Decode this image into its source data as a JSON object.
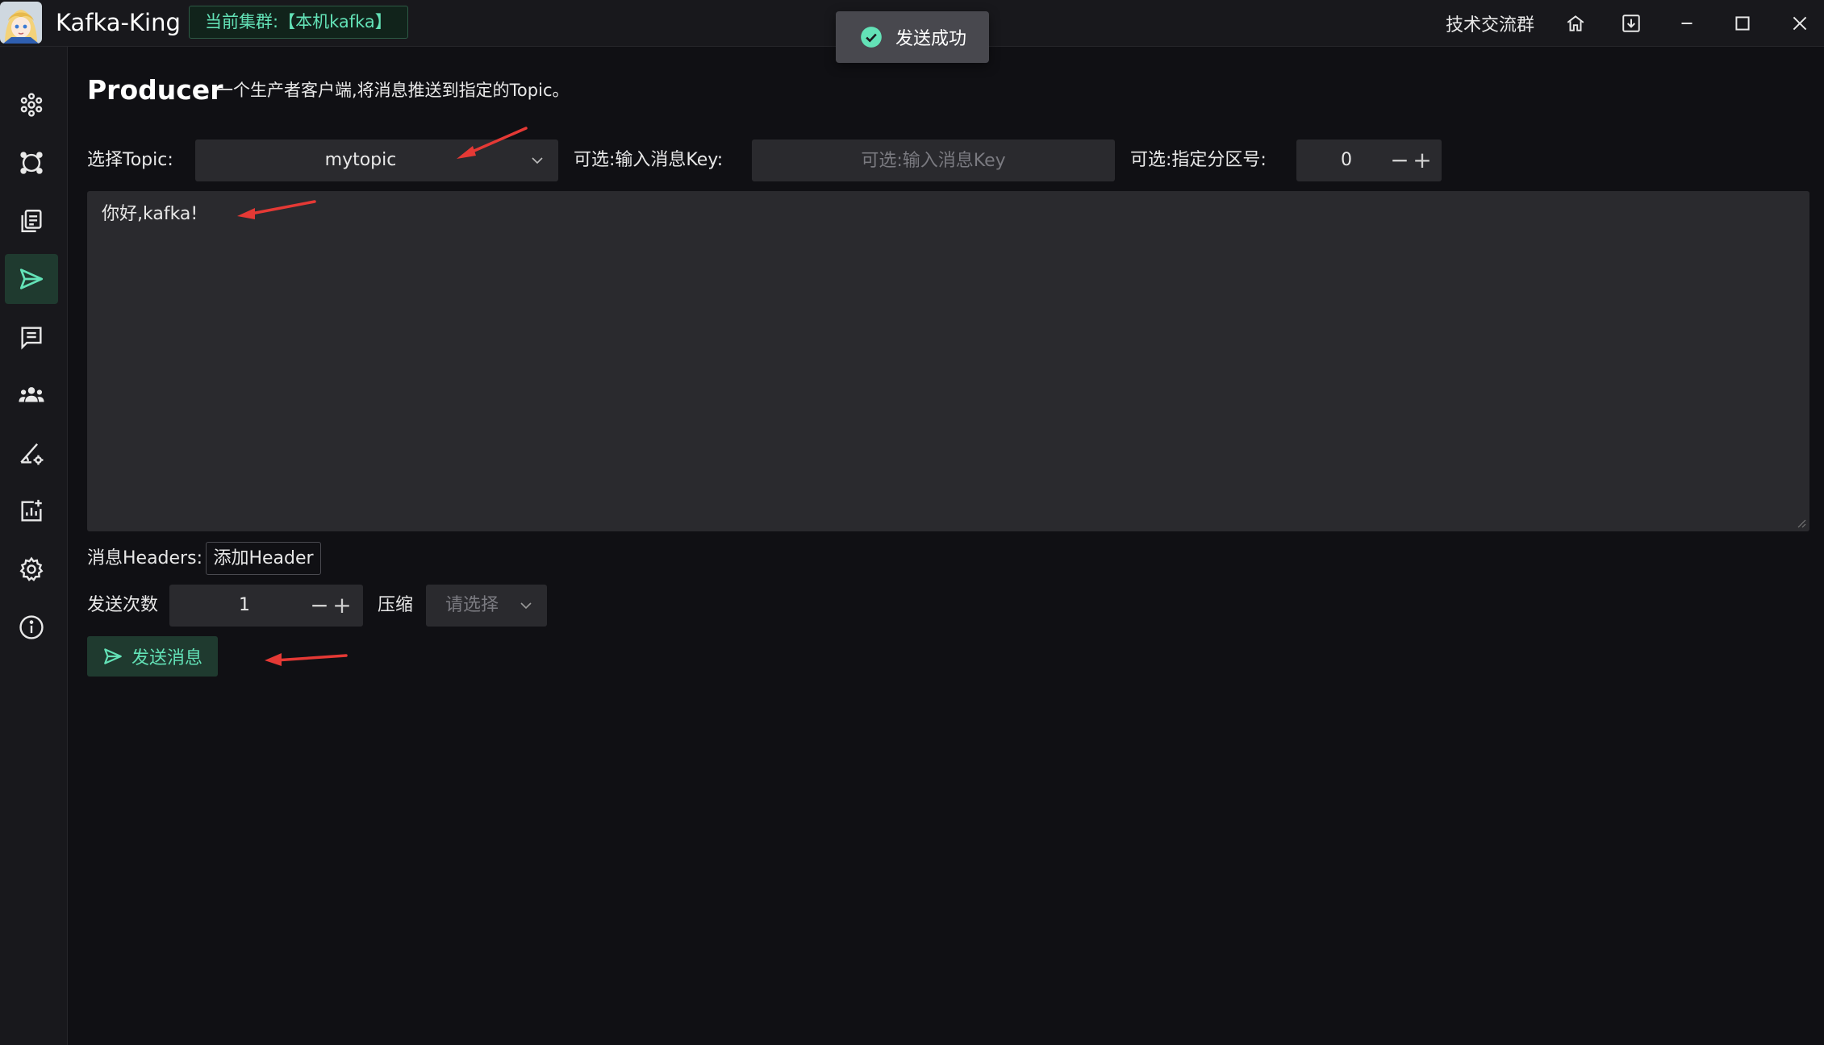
{
  "window": {
    "app_title": "Kafka-King",
    "cluster_tag": "当前集群:【本机kafka】",
    "community_link": "技术交流群",
    "icons": [
      "home-icon",
      "download-icon",
      "minimize-icon",
      "maximize-icon",
      "close-icon"
    ]
  },
  "toast": {
    "text": "发送成功",
    "icon": "check-circle-icon"
  },
  "sidebar": {
    "items": [
      {
        "icon": "cluster-icon",
        "name": "cluster"
      },
      {
        "icon": "node-icon",
        "name": "node"
      },
      {
        "icon": "topic-icon",
        "name": "topic"
      },
      {
        "icon": "send-icon",
        "name": "producer",
        "active": true
      },
      {
        "icon": "message-icon",
        "name": "consumer"
      },
      {
        "icon": "group-icon",
        "name": "group"
      },
      {
        "icon": "inspection-icon",
        "name": "inspection"
      },
      {
        "icon": "monitor-icon",
        "name": "monitor"
      },
      {
        "icon": "settings-icon",
        "name": "settings"
      },
      {
        "icon": "info-icon",
        "name": "about"
      }
    ]
  },
  "page": {
    "title": "Producer",
    "description": "一个生产者客户端,将消息推送到指定的Topic。"
  },
  "form": {
    "topic_label": "选择Topic:",
    "topic_value": "mytopic",
    "key_label": "可选:输入消息Key:",
    "key_placeholder": "可选:输入消息Key",
    "partition_label": "可选:指定分区号:",
    "partition_value": "0",
    "message": "你好,kafka!",
    "headers_label": "消息Headers:",
    "add_header": "添加Header",
    "send_times_label": "发送次数",
    "send_times_value": "1",
    "compress_label": "压缩",
    "compress_placeholder": "请选择",
    "send_button": "发送消息"
  },
  "colors": {
    "accent": "#63e2b7",
    "background": "#101014",
    "panel": "#18181c",
    "input": "#2a2a2e",
    "annotation_arrow": "#e53935"
  }
}
